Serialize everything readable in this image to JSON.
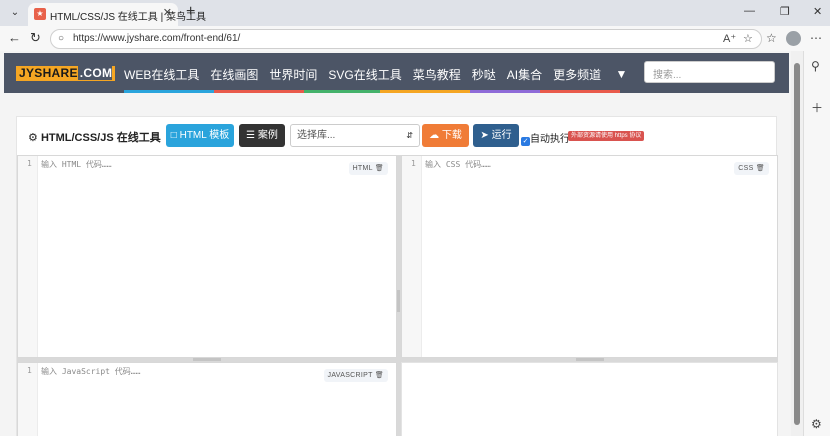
{
  "browser": {
    "tab_title": "HTML/CSS/JS 在线工具 | 菜鸟工具",
    "tab_close": "✕",
    "new_tab": "+",
    "url": "https://www.jyshare.com/front-end/61/",
    "icons": {
      "tab_menu": "chevron-down-icon",
      "back": "back-arrow-icon",
      "refresh": "refresh-icon",
      "lock": "lock-icon",
      "read_aloud": "read-aloud-icon",
      "favorite": "star-icon",
      "favorites": "favorites-icon",
      "profile": "profile-icon",
      "menu": "more-icon",
      "search_side": "search-icon",
      "add_side": "plus-icon",
      "settings": "gear-icon"
    }
  },
  "site": {
    "logo_main": "JYSHARE",
    "logo_suffix": ".COM",
    "nav": [
      "WEB在线工具",
      "在线画图",
      "世界时间",
      "SVG在线工具",
      "菜鸟教程",
      "秒哒",
      "AI集合",
      "更多频道"
    ],
    "search_placeholder": "搜索...",
    "colors": {
      "navbar": "#4c5566",
      "logo": "#f5a623",
      "stripes": [
        "#2aa4dc",
        "#e95a4b",
        "#44b26b",
        "#f5a623",
        "#8e6bd8",
        "#e95a4b"
      ]
    }
  },
  "tool": {
    "title": "HTML/CSS/JS 在线工具",
    "html_template_button": "HTML 模板",
    "case_button": "案例",
    "library_select": "选择库...",
    "download_button": "下载",
    "run_button": "运行",
    "auto_run_label": "自动执行",
    "auto_run_checked": true,
    "warning_badge": "外部资源请使用 https 协议",
    "colors": {
      "html_button": "#2aa4dc",
      "case_button": "#333333",
      "download_button": "#f07c37",
      "run_button": "#2f5f8e",
      "warning": "#d9534f"
    }
  },
  "editors": {
    "html": {
      "line": "1",
      "placeholder": "输入 HTML 代码……",
      "tag": "HTML"
    },
    "css": {
      "line": "1",
      "placeholder": "输入 CSS 代码……",
      "tag": "CSS"
    },
    "js": {
      "line": "1",
      "placeholder": "输入 JavaScript 代码……",
      "tag": "JAVASCRIPT"
    }
  }
}
